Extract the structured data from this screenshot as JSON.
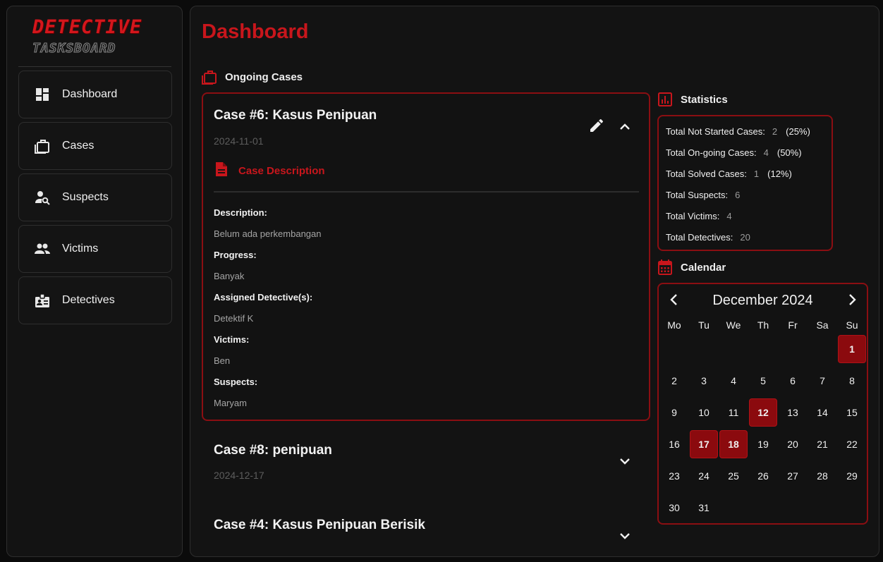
{
  "logo": {
    "line1": "DETECTIVE",
    "line2": "TASKSBOARD"
  },
  "sidebar": {
    "items": [
      {
        "label": "Dashboard",
        "icon": "dashboard-icon"
      },
      {
        "label": "Cases",
        "icon": "briefcase-icon"
      },
      {
        "label": "Suspects",
        "icon": "person-search-icon"
      },
      {
        "label": "Victims",
        "icon": "people-icon"
      },
      {
        "label": "Detectives",
        "icon": "badge-icon"
      }
    ]
  },
  "main": {
    "title": "Dashboard",
    "ongoing_label": "Ongoing Cases",
    "cases": [
      {
        "title": "Case #6: Kasus Penipuan",
        "date": "2024-11-01",
        "description_heading": "Case Description",
        "fields": [
          {
            "label": "Description:",
            "value": "Belum ada perkembangan"
          },
          {
            "label": "Progress:",
            "value": "Banyak"
          },
          {
            "label": "Assigned Detective(s):",
            "value": "Detektif K"
          },
          {
            "label": "Victims:",
            "value": "Ben"
          },
          {
            "label": "Suspects:",
            "value": "Maryam"
          }
        ]
      },
      {
        "title": "Case #8: penipuan",
        "date": "2024-12-17"
      },
      {
        "title": "Case #4: Kasus Penipuan Berisik"
      }
    ]
  },
  "statistics": {
    "label": "Statistics",
    "rows": [
      {
        "label": "Total Not Started Cases:",
        "value": "2",
        "pct": "(25%)"
      },
      {
        "label": "Total On-going Cases:",
        "value": "4",
        "pct": "(50%)"
      },
      {
        "label": "Total Solved Cases:",
        "value": "1",
        "pct": "(12%)"
      },
      {
        "label": "Total Suspects:",
        "value": "6"
      },
      {
        "label": "Total Victims:",
        "value": "4"
      },
      {
        "label": "Total Detectives:",
        "value": "20"
      }
    ]
  },
  "calendar": {
    "label": "Calendar",
    "month": "December 2024",
    "weekdays": [
      "Mo",
      "Tu",
      "We",
      "Th",
      "Fr",
      "Sa",
      "Su"
    ],
    "first_weekday_index": 6,
    "days_in_month": 31,
    "marked_days": [
      1,
      12,
      17,
      18
    ]
  },
  "colors": {
    "accent": "#c8161c",
    "border_accent": "#8b0e12",
    "marked_day": "#8b0a0e",
    "background": "#131313"
  }
}
